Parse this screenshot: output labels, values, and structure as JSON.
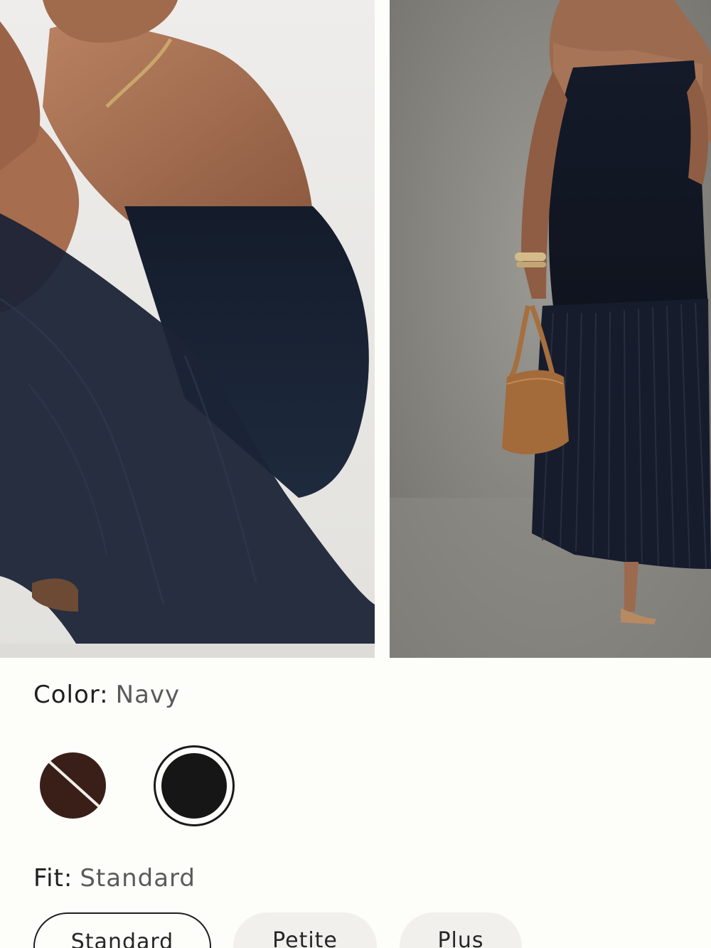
{
  "product": {
    "images": [
      {
        "alt": "model crouching in navy sheer maxi skirt"
      },
      {
        "alt": "model in navy strapless pleated dress with tan bag"
      }
    ],
    "color": {
      "label": "Color:",
      "selected": "Navy",
      "swatches": [
        {
          "name": "brown",
          "hex": "#3a1f19",
          "available": false
        },
        {
          "name": "navy",
          "hex": "#161616",
          "available": true,
          "selected": true
        }
      ]
    },
    "fit": {
      "label": "Fit:",
      "selected": "Standard",
      "options": [
        {
          "label": "Standard",
          "selected": true
        },
        {
          "label": "Petite",
          "selected": false
        },
        {
          "label": "Plus",
          "selected": false
        }
      ]
    }
  },
  "colors": {
    "background": "#fdfdfa",
    "text": "#1f1f1f",
    "muted_text": "#5a5a5a",
    "pill_bg": "#f1f0ec"
  }
}
